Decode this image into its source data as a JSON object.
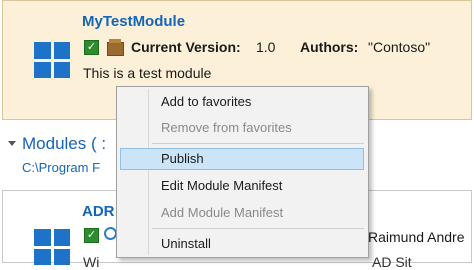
{
  "card1": {
    "title": "MyTestModule",
    "version_label": "Current Version:",
    "version_value": "1.0",
    "authors_label": "Authors:",
    "authors_value": "\"Contoso\"",
    "description": "This is a test module",
    "icons": [
      "powershell-module-icon",
      "checkmark-icon",
      "package-icon"
    ]
  },
  "section": {
    "header": "Modules ( :",
    "path": "C:\\Program F"
  },
  "card2": {
    "title": "ADR",
    "author_partial": "Raimund Andre",
    "desc_partial": "Wi",
    "desc_tail": "AD Sit",
    "icons": [
      "powershell-module-icon",
      "checkmark-icon",
      "globe-icon"
    ]
  },
  "context_menu": {
    "items": [
      {
        "label": "Add to favorites",
        "enabled": true
      },
      {
        "label": "Remove from favorites",
        "enabled": false
      },
      {
        "label": "Publish",
        "enabled": true,
        "highlighted": true
      },
      {
        "label": "Edit Module Manifest",
        "enabled": true
      },
      {
        "label": "Add Module Manifest",
        "enabled": false
      },
      {
        "label": "Uninstall",
        "enabled": true
      }
    ]
  },
  "colors": {
    "accent_blue": "#1565b8",
    "card_highlight": "#fcf1d8",
    "menu_highlight": "#cce4f7"
  }
}
